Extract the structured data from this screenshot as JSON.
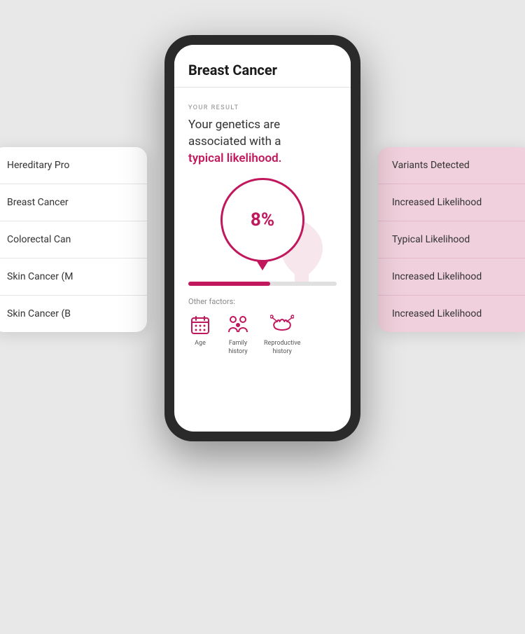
{
  "scene": {
    "background_color": "#e8e8e8"
  },
  "left_panel": {
    "items": [
      {
        "label": "Hereditary Pro"
      },
      {
        "label": "Breast Cancer"
      },
      {
        "label": "Colorectal Can"
      },
      {
        "label": "Skin Cancer (M"
      },
      {
        "label": "Skin Cancer (B"
      }
    ]
  },
  "right_panel": {
    "items": [
      {
        "label": "Variants Detected"
      },
      {
        "label": "Increased Likelihood"
      },
      {
        "label": "Typical Likelihood"
      },
      {
        "label": "Increased Likelihood"
      },
      {
        "label": "Increased Likelihood"
      }
    ]
  },
  "phone": {
    "title": "Breast Cancer",
    "result_label": "YOUR RESULT",
    "result_text_1": "Your genetics are associated with a",
    "result_highlight": "typical likelihood.",
    "gauge_value": "8%",
    "progress_percent": 55,
    "other_factors_label": "Other factors:",
    "factors": [
      {
        "label": "Age",
        "icon": "calendar-icon"
      },
      {
        "label": "Family\nhistory",
        "icon": "family-icon"
      },
      {
        "label": "Reproductive\nhistory",
        "icon": "reproductive-icon"
      }
    ]
  }
}
